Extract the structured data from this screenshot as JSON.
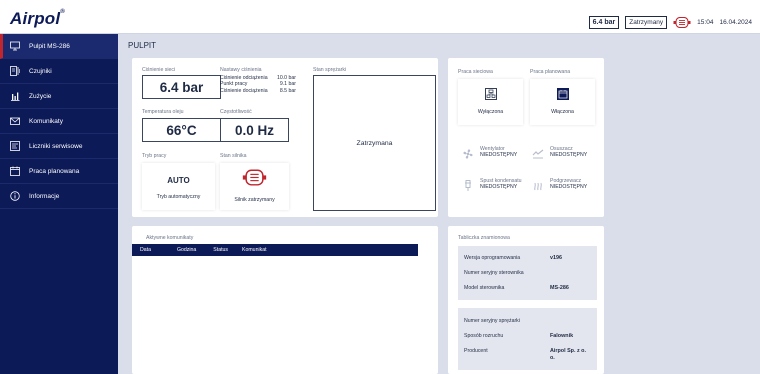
{
  "header": {
    "logo": "Airpol",
    "logo_mark": "®",
    "pressure": "6.4 bar",
    "status": "Zatrzymany",
    "time": "15:04",
    "date": "16.04.2024"
  },
  "sidebar": {
    "items": [
      {
        "label": "Pulpit MS-286",
        "icon": "monitor-icon",
        "active": true
      },
      {
        "label": "Czujniki",
        "icon": "sensor-icon"
      },
      {
        "label": "Zużycie",
        "icon": "bar-chart-icon"
      },
      {
        "label": "Komunikaty",
        "icon": "envelope-icon"
      },
      {
        "label": "Liczniki serwisowe",
        "icon": "counter-icon"
      },
      {
        "label": "Praca planowana",
        "icon": "calendar-icon"
      },
      {
        "label": "Informacje",
        "icon": "info-icon"
      }
    ]
  },
  "page_title": "PULPIT",
  "status_card": {
    "pressure_label": "Ciśnienie sieci",
    "pressure_value": "6.4 bar",
    "settings_label": "Nastawy ciśnienia",
    "settings": [
      {
        "name": "Ciśnienie odciążenia",
        "value": "10.0 bar"
      },
      {
        "name": "Punkt pracy",
        "value": "9.1 bar"
      },
      {
        "name": "Ciśnienie dociążenia",
        "value": "8.5 bar"
      }
    ],
    "oil_temp_label": "Temperatura oleju",
    "oil_temp_value": "66°C",
    "frequency_label": "Częstotliwość",
    "frequency_value": "0.0 Hz",
    "mode_label": "Tryb pracy",
    "mode_value": "AUTO",
    "mode_desc": "Tryb automatyczny",
    "motor_label": "Stan silnika",
    "motor_desc": "Silnik zatrzymany",
    "compressor_label": "Stan sprężarki",
    "compressor_state": "Zatrzymana"
  },
  "work_card": {
    "network_label": "Praca sieciowa",
    "network_state": "Wyłączona",
    "planned_label": "Praca planowana",
    "planned_state": "Włączona",
    "devices": [
      {
        "name": "Wentylator",
        "state": "NIEDOSTĘPNY",
        "icon": "fan-icon"
      },
      {
        "name": "Osuszacz",
        "state": "NIEDOSTĘPNY",
        "icon": "dryer-icon"
      },
      {
        "name": "Spust kondensatu",
        "state": "NIEDOSTĘPNY",
        "icon": "drain-icon"
      },
      {
        "name": "Podgrzewacz",
        "state": "NIEDOSTĘPNY",
        "icon": "heater-icon"
      }
    ]
  },
  "messages_card": {
    "title": "Aktywne komunikaty",
    "columns": [
      "Data",
      "Godzina",
      "Status",
      "Komunikat"
    ]
  },
  "nameplate": {
    "title": "Tabliczka znamionowa",
    "box1": [
      {
        "label": "Wersja oprogramowania",
        "value": "v196"
      },
      {
        "label": "Numer seryjny sterownika",
        "value": ""
      },
      {
        "label": "Model sterownika",
        "value": "MS-286"
      }
    ],
    "box2": [
      {
        "label": "Numer seryjny sprężarki",
        "value": ""
      },
      {
        "label": "Sposób rozruchu",
        "value": "Falownik"
      },
      {
        "label": "Producent",
        "value": "Airpol Sp. z o. o."
      }
    ]
  },
  "colors": {
    "navy": "#0d1a58",
    "accent_red": "#c0262d",
    "background": "#d9deea"
  }
}
